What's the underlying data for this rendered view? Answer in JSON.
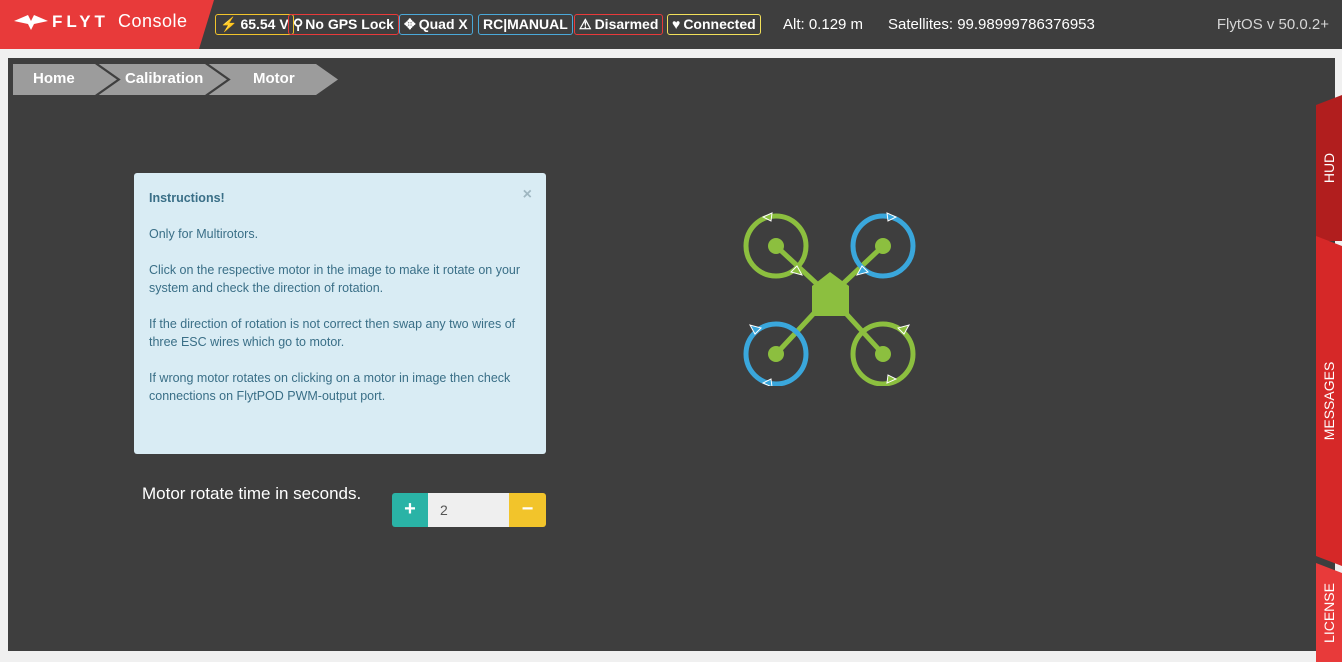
{
  "brand": {
    "bold": "FLYT",
    "light": "Console",
    "logo_icon": "flyt-logo-icon"
  },
  "status": {
    "badges": [
      {
        "icon": "lightning-icon",
        "glyph": "⚡",
        "label": "65.54 V",
        "color": "#f2c42b"
      },
      {
        "icon": "map-marker-icon",
        "glyph": "⚲",
        "label": "No GPS Lock",
        "color": "#e83a3a"
      },
      {
        "icon": "arrows-move-icon",
        "glyph": "✥",
        "label": "Quad X",
        "color": "#4aa8d8"
      },
      {
        "icon": "",
        "glyph": "",
        "label": "RC|MANUAL",
        "color": "#4aa8d8"
      },
      {
        "icon": "warning-icon",
        "glyph": "⚠",
        "label": "Disarmed",
        "color": "#e83a3a"
      },
      {
        "icon": "heart-icon",
        "glyph": "♥",
        "label": "Connected",
        "color": "#f2e05a"
      }
    ],
    "altitude": "Alt: 0.129 m",
    "satellites": "Satellites: 99.98999786376953",
    "version": "FlytOS v 50.0.2+"
  },
  "breadcrumb": [
    "Home",
    "Calibration",
    "Motor"
  ],
  "instructions": {
    "title": "Instructions!",
    "close": "×",
    "lines": [
      "Only for Multirotors.",
      "Click on the respective motor in the image to make it rotate on your system and check the direction of rotation.",
      "If the direction of rotation is not correct then swap any two wires of three ESC wires which go to motor.",
      "If wrong motor rotates on clicking on a motor in image then check connections on FlytPOD PWM-output port."
    ]
  },
  "motor_time": {
    "label": "Motor rotate time in seconds.",
    "plus": "+",
    "minus": "−",
    "value": "2"
  },
  "colors": {
    "green": "#8cbf3f",
    "blue": "#3aa7dc",
    "red": "#e83a3a",
    "dark_red": "#b11e1e"
  },
  "sidetabs": [
    "HUD",
    "MESSAGES",
    "LICENSE"
  ]
}
